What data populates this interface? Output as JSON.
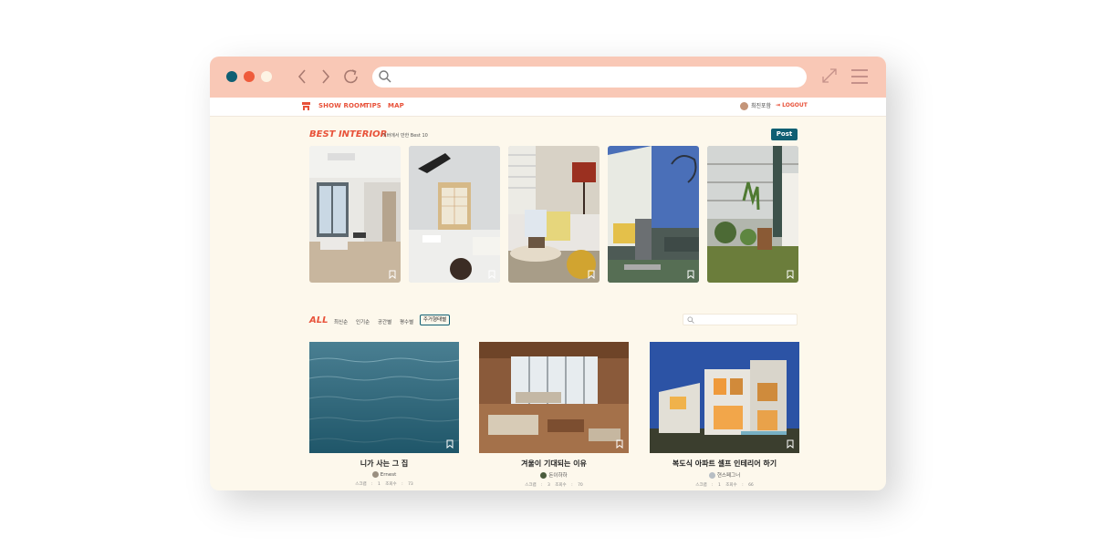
{
  "browser": {
    "nav_back": "‹",
    "nav_forward": "›"
  },
  "topnav": {
    "links": [
      "SHOW ROOM",
      "TIPS",
      "MAP"
    ],
    "user_name": "최진포함",
    "logout": "LOGOUT"
  },
  "best": {
    "title": "BEST INTERIOR",
    "subtitle": "이버에서 만한 Best 10",
    "post_button": "Post"
  },
  "filters": {
    "all": "ALL",
    "items": [
      "최신순",
      "인기순",
      "공간별",
      "평수별"
    ],
    "active": "주거형태별"
  },
  "posts": [
    {
      "title": "니가 사는 그 집",
      "author": "Ernest",
      "meta": "스크랩 : 1 조회수 : 73"
    },
    {
      "title": "겨울이 기대되는 이유",
      "author": "돈이하하",
      "meta": "스크랩 : 3 조회수 : 70"
    },
    {
      "title": "복도식 아파트 셀프 인테리어 하기",
      "author": "현스페그너",
      "meta": "스크랩 : 1 조회수 : 66"
    }
  ],
  "colors": {
    "chrome": "#f9c8b6",
    "accent": "#e8523a",
    "teal": "#0f5f73",
    "page_bg": "#fdf8ec"
  }
}
